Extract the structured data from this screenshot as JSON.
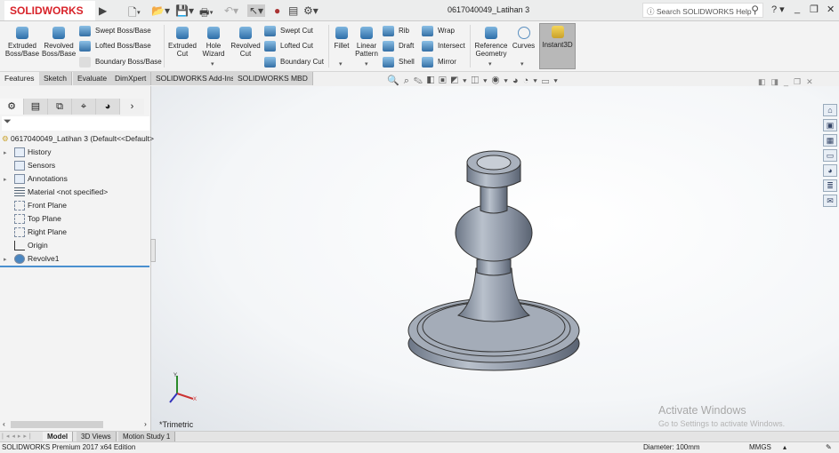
{
  "app": {
    "logo": "SOLIDWORKS",
    "document_title": "0617040049_Latihan 3",
    "search_placeholder": "Search SOLIDWORKS Help"
  },
  "ribbon": {
    "extruded_boss": "Extruded Boss/Base",
    "revolved_boss": "Revolved Boss/Base",
    "swept_boss": "Swept Boss/Base",
    "lofted_boss": "Lofted Boss/Base",
    "boundary_boss": "Boundary Boss/Base",
    "extruded_cut": "Extruded Cut",
    "hole_wizard": "Hole Wizard",
    "revolved_cut": "Revolved Cut",
    "swept_cut": "Swept Cut",
    "lofted_cut": "Lofted Cut",
    "boundary_cut": "Boundary Cut",
    "fillet": "Fillet",
    "linear_pattern": "Linear Pattern",
    "rib": "Rib",
    "draft": "Draft",
    "shell": "Shell",
    "wrap": "Wrap",
    "intersect": "Intersect",
    "mirror": "Mirror",
    "reference_geometry": "Reference Geometry",
    "curves": "Curves",
    "instant3d": "Instant3D"
  },
  "tabs": [
    "Features",
    "Sketch",
    "Evaluate",
    "DimXpert",
    "SOLIDWORKS Add-Ins",
    "SOLIDWORKS MBD"
  ],
  "tree": {
    "root": "0617040049_Latihan 3  (Default<<Default>",
    "items": [
      "History",
      "Sensors",
      "Annotations",
      "Material <not specified>",
      "Front Plane",
      "Top Plane",
      "Right Plane",
      "Origin",
      "Revolve1"
    ]
  },
  "viewport": {
    "view_label": "*Trimetric",
    "watermark_title": "Activate Windows",
    "watermark_sub": "Go to Settings to activate Windows.",
    "axis_x": "X",
    "axis_y": "Y"
  },
  "bottom_tabs": [
    "Model",
    "3D Views",
    "Motion Study 1"
  ],
  "status": {
    "edition": "SOLIDWORKS Premium 2017 x64 Edition",
    "measure": "Diameter: 100mm",
    "units": "MMGS"
  }
}
